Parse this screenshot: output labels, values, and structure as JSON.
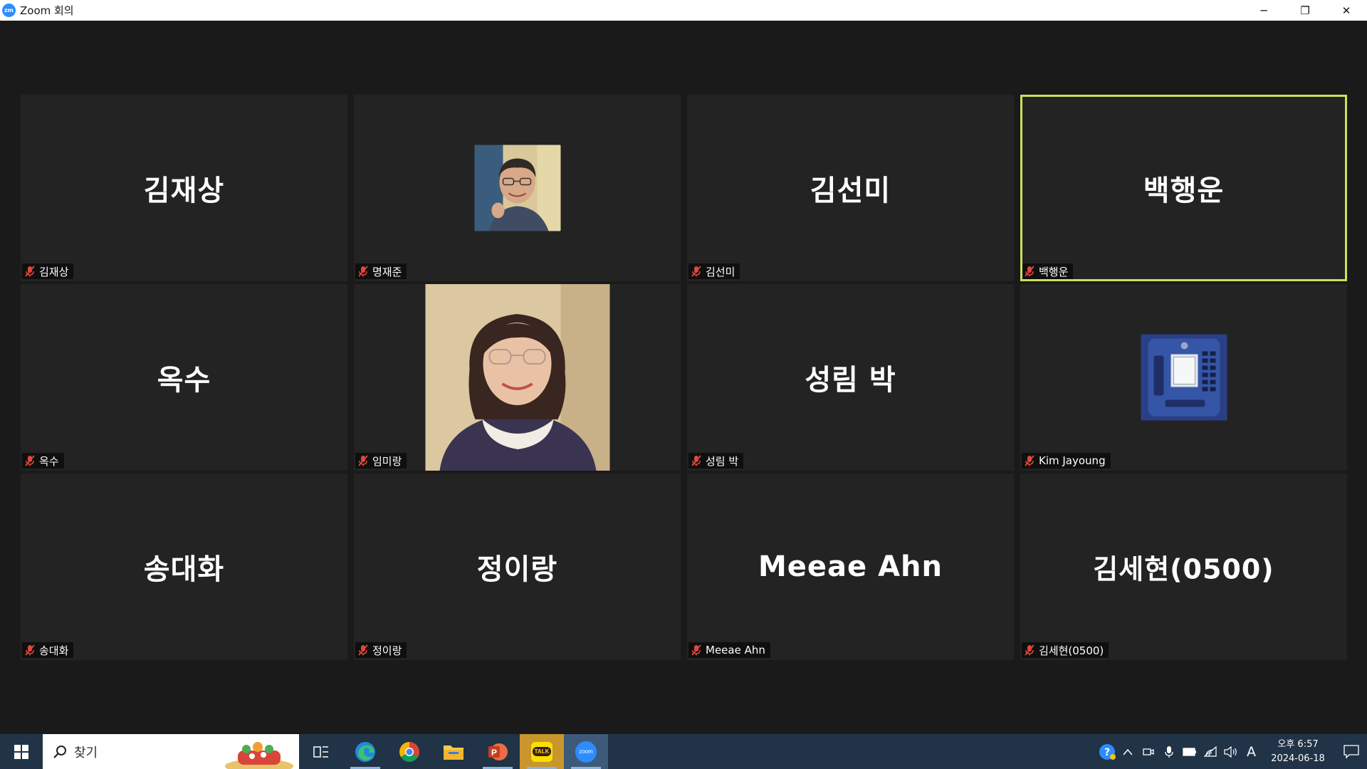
{
  "window": {
    "title": "Zoom 회의",
    "app_icon_text": "zm",
    "minimize": "─",
    "restore": "❐",
    "close": "✕"
  },
  "participants": [
    {
      "display_name": "김재상",
      "tag": "김재상",
      "view": "name"
    },
    {
      "display_name": "",
      "tag": "명재준",
      "view": "photo"
    },
    {
      "display_name": "김선미",
      "tag": "김선미",
      "view": "name"
    },
    {
      "display_name": "백행운",
      "tag": "백행운",
      "view": "name",
      "active_speaker": true
    },
    {
      "display_name": "옥수",
      "tag": "옥수",
      "view": "name"
    },
    {
      "display_name": "",
      "tag": "임미랑",
      "view": "photo"
    },
    {
      "display_name": "성림 박",
      "tag": "성림 박",
      "view": "name"
    },
    {
      "display_name": "",
      "tag": "Kim Jayoung",
      "view": "photo"
    },
    {
      "display_name": "송대화",
      "tag": "송대화",
      "view": "name"
    },
    {
      "display_name": "정이랑",
      "tag": "정이랑",
      "view": "name"
    },
    {
      "display_name": "Meeae Ahn",
      "tag": "Meeae Ahn",
      "view": "name"
    },
    {
      "display_name": "김세현(0500)",
      "tag": "김세현(0500)",
      "view": "name"
    }
  ],
  "taskbar": {
    "search_placeholder": "찾기",
    "apps": [
      "task-view",
      "edge",
      "chrome",
      "file-explorer",
      "powerpoint",
      "kakaotalk",
      "zoom"
    ],
    "kakao_label": "TALK",
    "zoom_label": "zoom",
    "tray_ime": "A",
    "clock_time": "오후 6:57",
    "clock_date": "2024-06-18"
  },
  "colors": {
    "active_speaker_border": "#cbe25a",
    "muted_mic": "#e0473d",
    "tile_bg": "#232323",
    "taskbar_bg": "#203347"
  }
}
